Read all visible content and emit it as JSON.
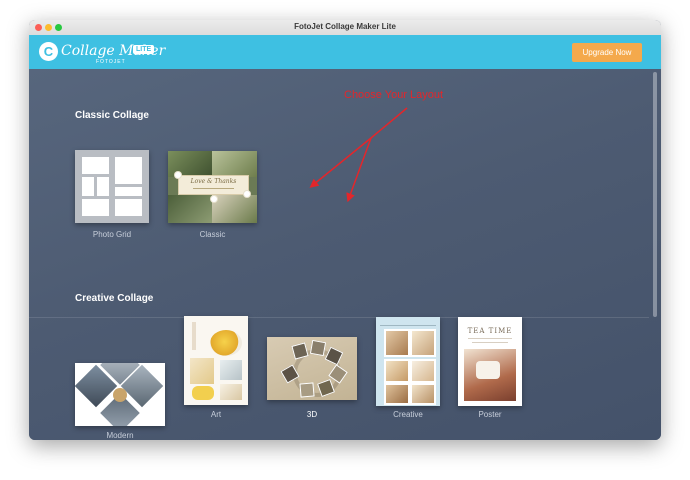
{
  "window": {
    "title": "FotoJet Collage Maker Lite"
  },
  "header": {
    "logo_text": "Collage Maker",
    "logo_badge": "LITE",
    "logo_sub": "FOTOJET",
    "upgrade_label": "Upgrade Now"
  },
  "annotation": {
    "text": "Choose Your Layout"
  },
  "sections": [
    {
      "title": "Classic Collage",
      "items": [
        {
          "label": "Photo Grid"
        },
        {
          "label": "Classic",
          "banner_text": "Love & Thanks"
        }
      ]
    },
    {
      "title": "Creative Collage",
      "items": [
        {
          "label": "Modern"
        },
        {
          "label": "Art"
        },
        {
          "label": "3D"
        },
        {
          "label": "Creative"
        },
        {
          "label": "Poster",
          "poster_text": "TEA TIME"
        }
      ]
    }
  ],
  "colors": {
    "header_bg": "#3ec0e2",
    "upgrade_bg": "#f4a94c",
    "annotation": "#e3262b",
    "content_bg": "#4d5b72"
  },
  "icons": [
    "collage-maker-logo-icon"
  ]
}
